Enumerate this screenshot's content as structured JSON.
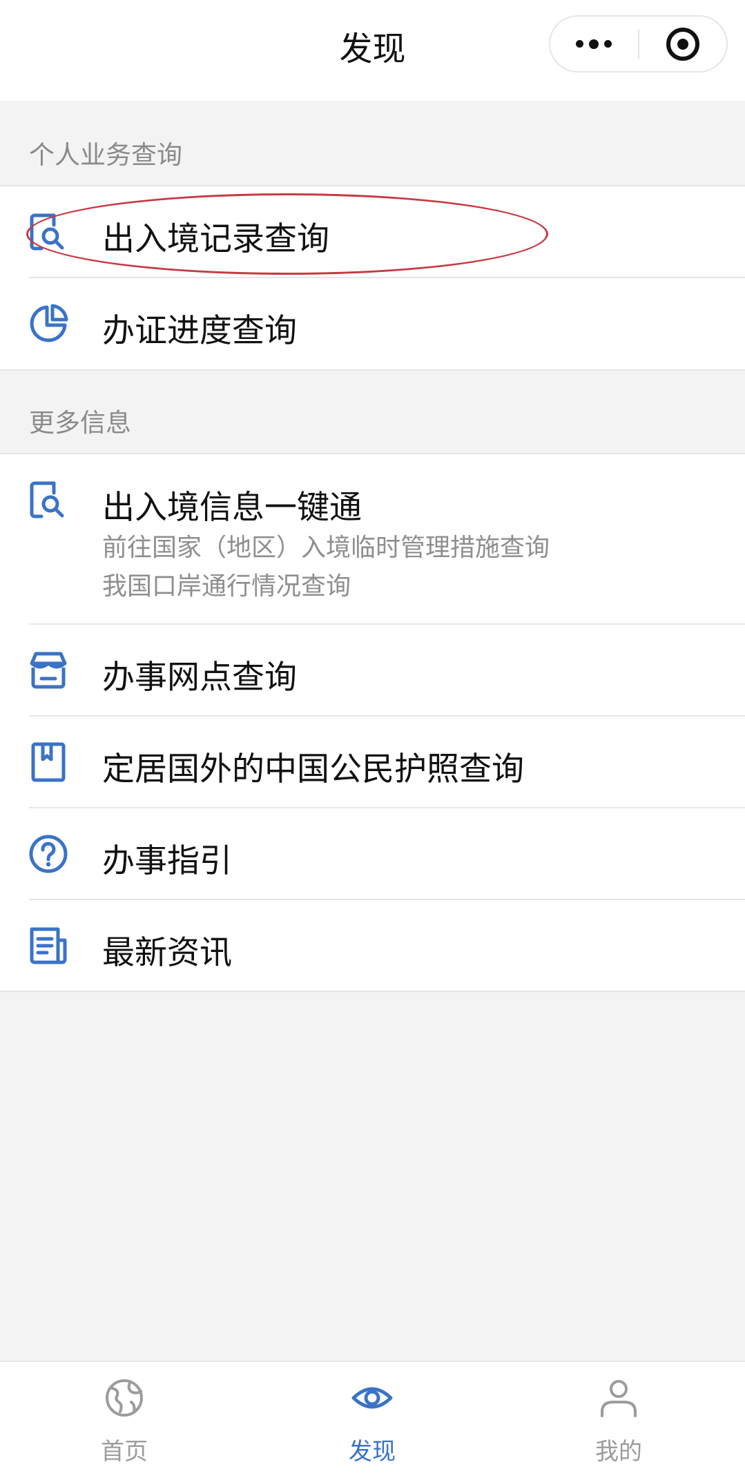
{
  "header": {
    "title": "发现"
  },
  "sections": [
    {
      "label": "个人业务查询",
      "items": [
        {
          "title": "出入境记录查询",
          "icon": "document-search-icon"
        },
        {
          "title": "办证进度查询",
          "icon": "pie-chart-icon"
        }
      ]
    },
    {
      "label": "更多信息",
      "items": [
        {
          "title": "出入境信息一键通",
          "icon": "document-search-icon",
          "sub1": "前往国家（地区）入境临时管理措施查询",
          "sub2": "我国口岸通行情况查询"
        },
        {
          "title": "办事网点查询",
          "icon": "store-icon"
        },
        {
          "title": "定居国外的中国公民护照查询",
          "icon": "passport-book-icon"
        },
        {
          "title": "办事指引",
          "icon": "question-circle-icon"
        },
        {
          "title": "最新资讯",
          "icon": "news-icon"
        }
      ]
    }
  ],
  "tabbar": {
    "items": [
      {
        "label": "首页",
        "icon": "globe-icon",
        "active": false
      },
      {
        "label": "发现",
        "icon": "eye-icon",
        "active": true
      },
      {
        "label": "我的",
        "icon": "user-icon",
        "active": false
      }
    ]
  },
  "colors": {
    "accent": "#3a73c7",
    "highlight": "#c63a44",
    "inactive": "#9c9c9c"
  }
}
